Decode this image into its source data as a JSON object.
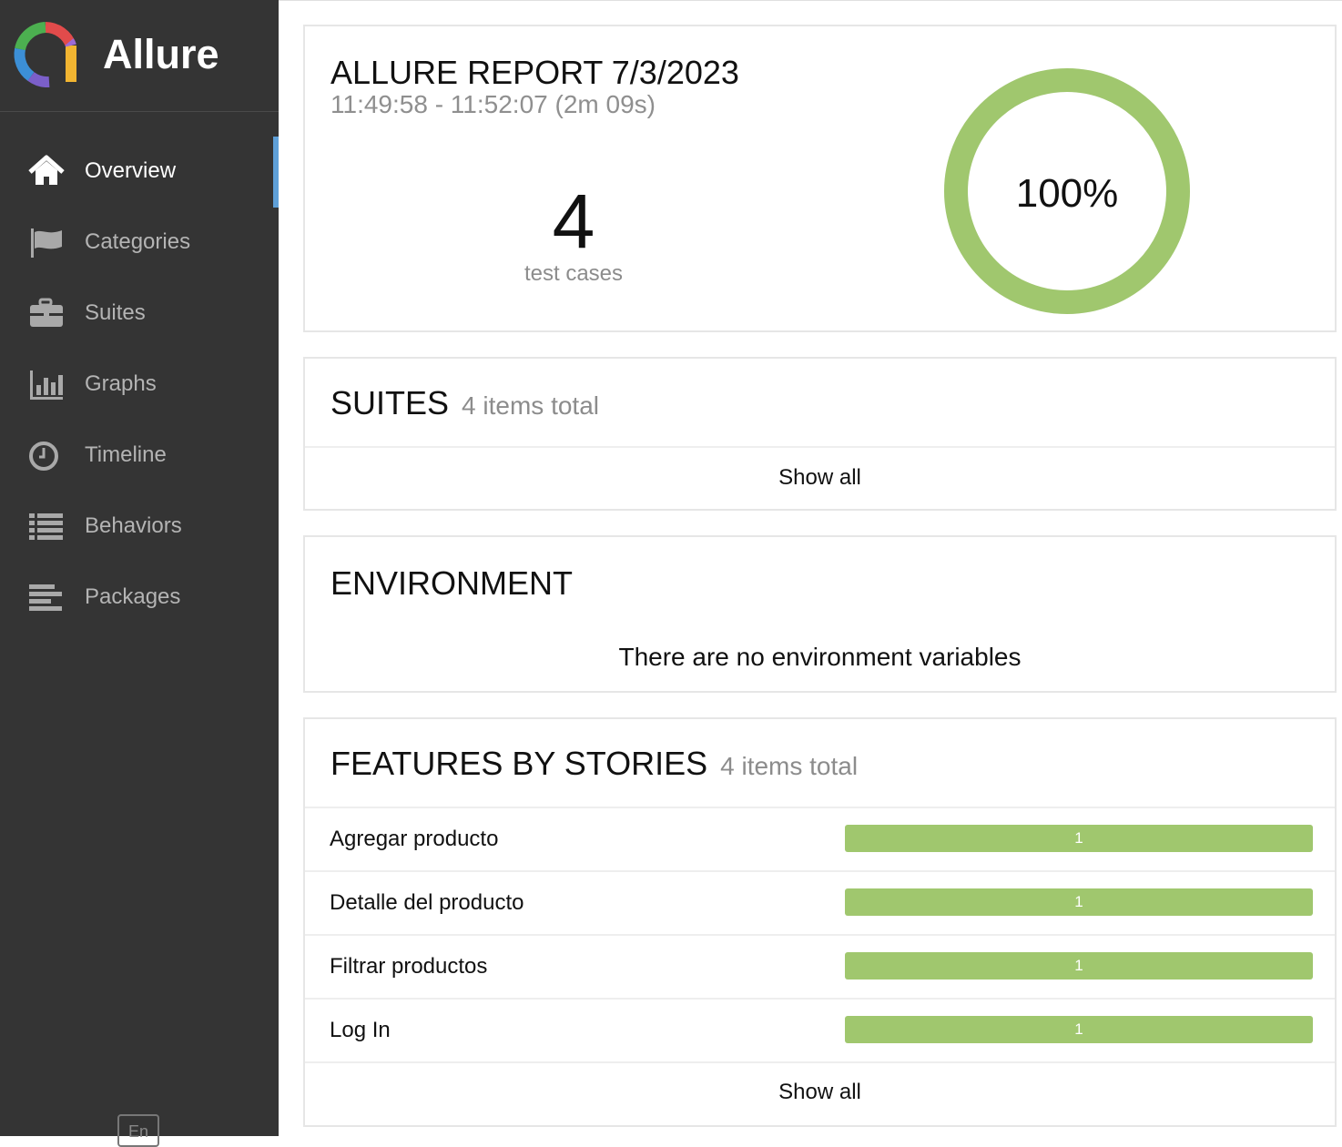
{
  "app": {
    "name": "Allure"
  },
  "sidebar": {
    "items": [
      {
        "label": "Overview",
        "icon": "home-icon",
        "active": true
      },
      {
        "label": "Categories",
        "icon": "flag-icon"
      },
      {
        "label": "Suites",
        "icon": "briefcase-icon"
      },
      {
        "label": "Graphs",
        "icon": "bar-chart-icon"
      },
      {
        "label": "Timeline",
        "icon": "clock-icon"
      },
      {
        "label": "Behaviors",
        "icon": "list-icon"
      },
      {
        "label": "Packages",
        "icon": "align-left-icon"
      }
    ],
    "language": "En"
  },
  "report": {
    "title": "ALLURE REPORT 7/3/2023",
    "time_range": "11:49:58 - 11:52:07 (2m 09s)",
    "test_count": "4",
    "test_count_caption": "test cases",
    "pass_percent_label": "100%",
    "pass_fraction": 1.0
  },
  "suites": {
    "title": "SUITES",
    "count_text": "4 items total",
    "show_all": "Show all"
  },
  "environment": {
    "title": "ENVIRONMENT",
    "empty_message": "There are no environment variables"
  },
  "features": {
    "title": "FEATURES BY STORIES",
    "count_text": "4 items total",
    "rows": [
      {
        "name": "Agregar producto",
        "passed": "1"
      },
      {
        "name": "Detalle del producto",
        "passed": "1"
      },
      {
        "name": "Filtrar productos",
        "passed": "1"
      },
      {
        "name": "Log In",
        "passed": "1"
      }
    ],
    "show_all": "Show all"
  },
  "colors": {
    "sidebar_bg": "#343434",
    "passed": "#a0c76e",
    "active_marker": "#5fa0d8"
  }
}
